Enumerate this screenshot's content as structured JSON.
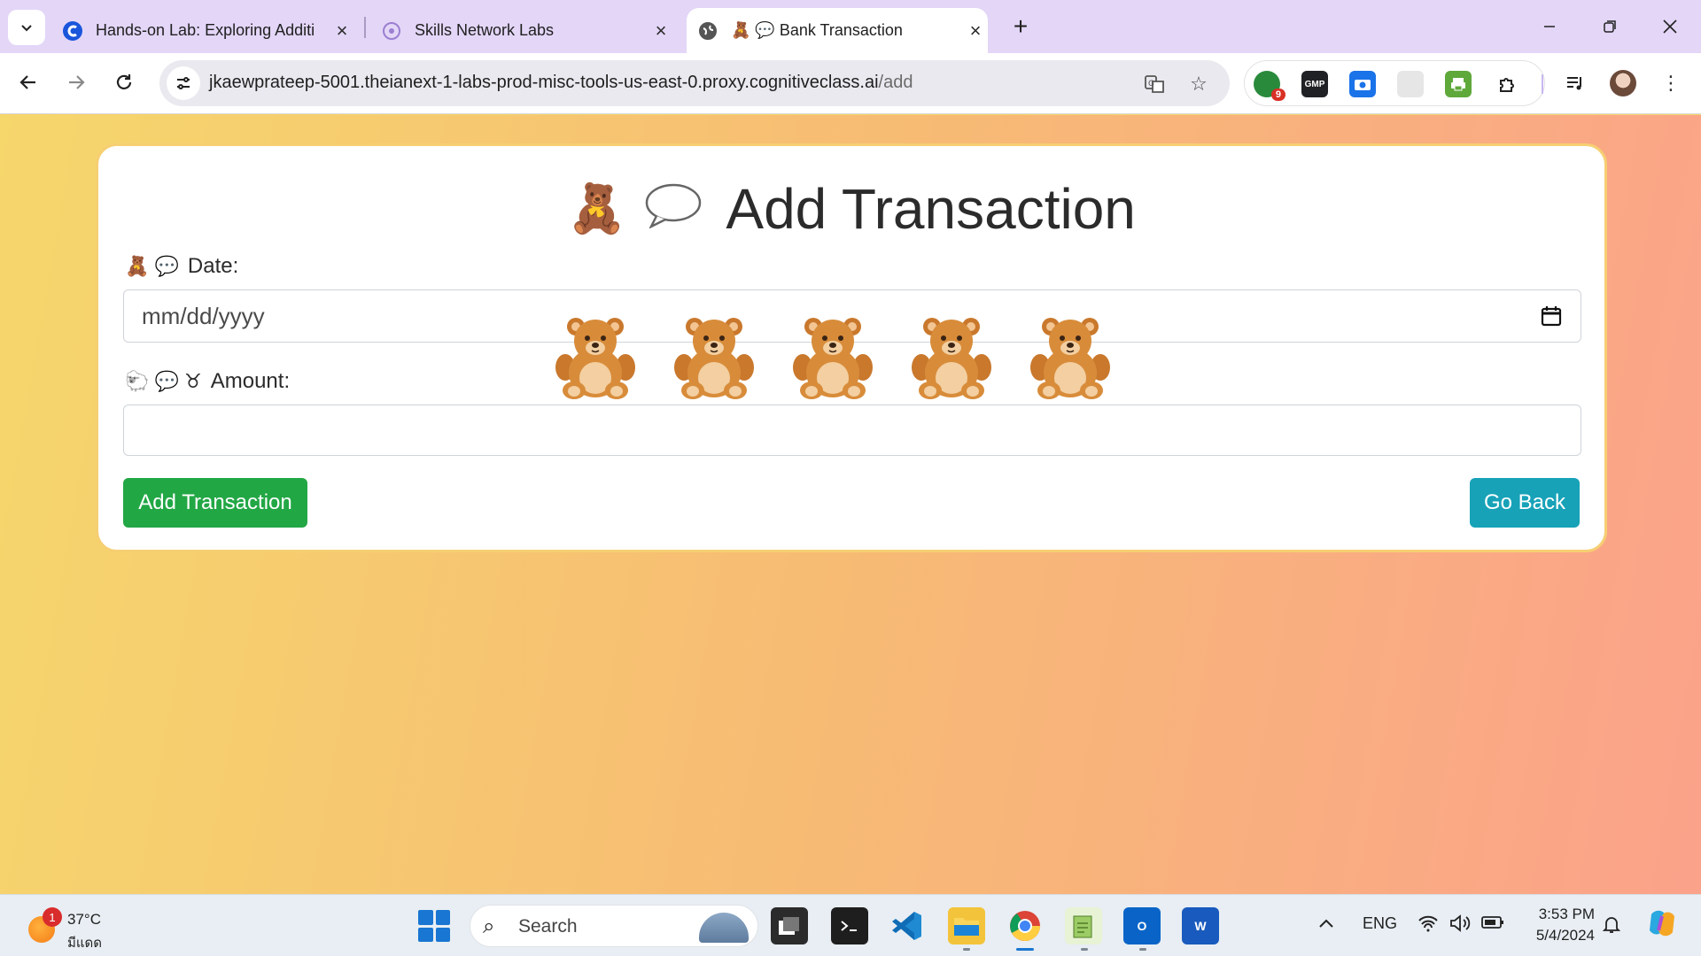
{
  "browser": {
    "tabs": [
      {
        "title": "Hands-on Lab: Exploring Additi",
        "favicon": "coursera-icon"
      },
      {
        "title": "Skills Network Labs",
        "favicon": "skills-network-icon"
      },
      {
        "title": "🧸 💬 Bank Transaction",
        "favicon": "globe-icon",
        "active": true
      }
    ],
    "url_host": "jkaewprateep-5001.theianext-1-labs-prod-misc-tools-us-east-0.proxy.cognitiveclass.ai",
    "url_path": "/add",
    "extension_badge": "9",
    "extension_gmp_label": "GMP"
  },
  "page": {
    "heading_emoji": "🧸",
    "heading": "Add Transaction",
    "date_label_emoji": "🧸 💬",
    "date_label": "Date:",
    "date_placeholder": "mm/dd/yyyy",
    "amount_label_emoji": "🐑 💬 ♉",
    "amount_label": "Amount:",
    "amount_value": "",
    "submit_button": "Add Transaction",
    "back_button": "Go Back",
    "bear_count": 5,
    "colors": {
      "submit": "#22a745",
      "back": "#17a2b8",
      "card_border": "#f6cf72",
      "gradient_start": "#f6d76c",
      "gradient_end": "#fba28a"
    }
  },
  "taskbar": {
    "weather_badge": "1",
    "temperature": "37°C",
    "weather_condition": "มีแดด",
    "search_placeholder": "Search",
    "language": "ENG",
    "time": "3:53 PM",
    "date": "5/4/2024"
  }
}
